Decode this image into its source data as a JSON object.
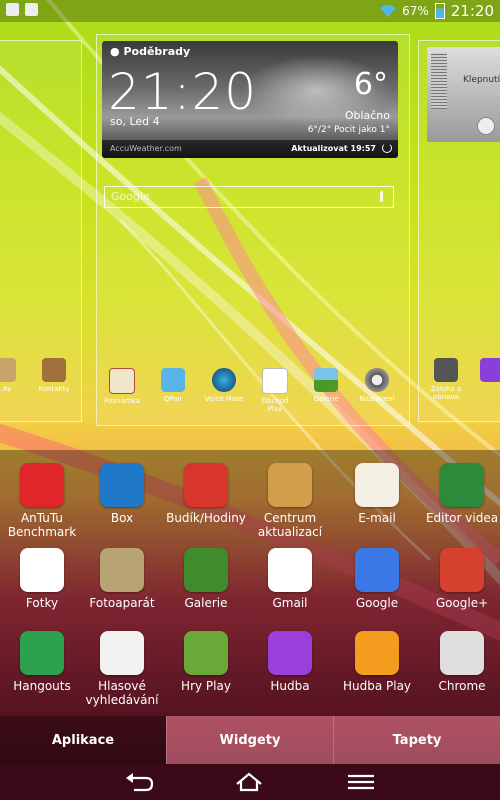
{
  "status_bar": {
    "battery": "67%",
    "time": "21:20"
  },
  "weather": {
    "city": "Poděbrady",
    "time": "21:20",
    "date": "so, Led 4",
    "temperature": "6°",
    "condition": "Oblačno",
    "range": "6°/2° Pocit jako 1°",
    "provider": "AccuWeather.com",
    "update_label": "Aktualizovat 19:57"
  },
  "search": {
    "placeholder": "Google"
  },
  "music_widget": {
    "text": "Klepnutí"
  },
  "home_icons": [
    {
      "label": "Poznámka"
    },
    {
      "label": "QPair"
    },
    {
      "label": "Voice Mate"
    },
    {
      "label": "Obchod Play"
    },
    {
      "label": "Galerie"
    },
    {
      "label": "Nastavení"
    }
  ],
  "left_panel_icons": [
    {
      "label": "...ky"
    },
    {
      "label": "Kontakty"
    }
  ],
  "right_panel_icons": [
    {
      "label": "Záloha a obnova"
    }
  ],
  "apps": [
    {
      "label": "AnTuTu Benchmark",
      "icon": "antutu-icon",
      "color": "#e0252b"
    },
    {
      "label": "Box",
      "icon": "box-icon",
      "color": "#1f79c8"
    },
    {
      "label": "Budík/Hodiny",
      "icon": "alarm-clock-icon",
      "color": "#d8352b"
    },
    {
      "label": "Centrum aktualizací",
      "icon": "update-center-icon",
      "color": "#d39e4a"
    },
    {
      "label": "E-mail",
      "icon": "email-icon",
      "color": "#f4f0e4"
    },
    {
      "label": "Editor videa",
      "icon": "video-editor-icon",
      "color": "#2c8a3a"
    },
    {
      "label": "Fotky",
      "icon": "photos-icon",
      "color": "#ffffff"
    },
    {
      "label": "Fotoaparát",
      "icon": "camera-icon",
      "color": "#b8a472"
    },
    {
      "label": "Galerie",
      "icon": "gallery-icon",
      "color": "#3f8c2e"
    },
    {
      "label": "Gmail",
      "icon": "gmail-icon",
      "color": "#ffffff"
    },
    {
      "label": "Google",
      "icon": "google-icon",
      "color": "#3b78e7"
    },
    {
      "label": "Google+",
      "icon": "google-plus-icon",
      "color": "#d6402f"
    },
    {
      "label": "Hangouts",
      "icon": "hangouts-icon",
      "color": "#2ca24e"
    },
    {
      "label": "Hlasové vyhledávání",
      "icon": "voice-search-icon",
      "color": "#f2f2f2"
    },
    {
      "label": "Hry Play",
      "icon": "play-games-icon",
      "color": "#6aa83a"
    },
    {
      "label": "Hudba",
      "icon": "music-icon",
      "color": "#9a3fd9"
    },
    {
      "label": "Hudba Play",
      "icon": "play-music-icon",
      "color": "#f39c1e"
    },
    {
      "label": "Chrome",
      "icon": "chrome-icon",
      "color": "#dedede"
    }
  ],
  "tabs": [
    {
      "label": "Aplikace",
      "active": true
    },
    {
      "label": "Widgety",
      "active": false
    },
    {
      "label": "Tapety",
      "active": false
    }
  ]
}
